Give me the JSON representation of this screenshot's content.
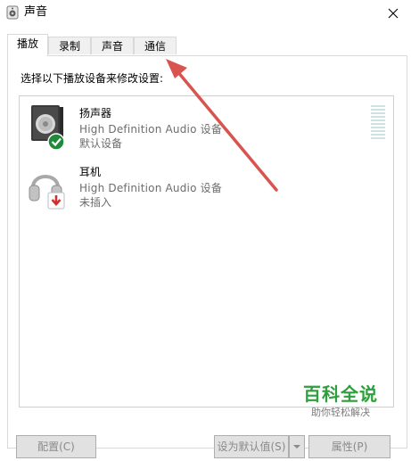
{
  "window": {
    "title": "声音",
    "icon": "speaker-icon",
    "close_icon": "close-icon"
  },
  "tabs": [
    {
      "label": "播放",
      "active": true
    },
    {
      "label": "录制",
      "active": false
    },
    {
      "label": "声音",
      "active": false
    },
    {
      "label": "通信",
      "active": false
    }
  ],
  "playback": {
    "instruction": "选择以下播放设备来修改设置:",
    "devices": [
      {
        "name": "扬声器",
        "description": "High Definition Audio 设备",
        "status": "默认设备",
        "icon": "speaker-device-icon",
        "badge": "green-check-badge-icon"
      },
      {
        "name": "耳机",
        "description": "High Definition Audio 设备",
        "status": "未插入",
        "icon": "headphones-device-icon",
        "badge": "red-down-arrow-badge-icon"
      }
    ]
  },
  "buttons": {
    "configure": "配置(C)",
    "set_default": "设为默认值(S)",
    "properties": "属性(P)"
  },
  "watermark": {
    "main": "百科全说",
    "sub": "助你轻松解决"
  },
  "colors": {
    "annotation_arrow": "#d9534f",
    "check_badge": "#1e8a3a",
    "down_badge": "#d32f2f",
    "watermark": "#2f9e3c"
  }
}
